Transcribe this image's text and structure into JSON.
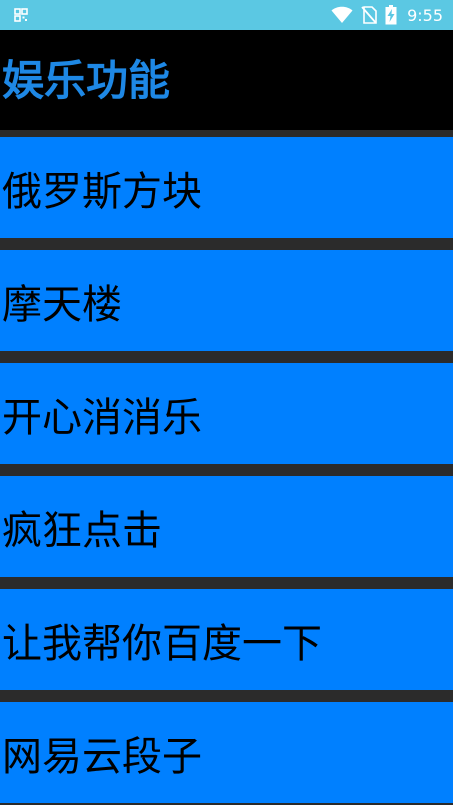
{
  "status_bar": {
    "time": "9:55",
    "icons": [
      "notification-grid-icon",
      "wifi-icon",
      "no-sim-icon",
      "battery-charging-icon"
    ]
  },
  "header": {
    "title": "娱乐功能"
  },
  "menu": {
    "items": [
      {
        "label": "俄罗斯方块"
      },
      {
        "label": "摩天楼"
      },
      {
        "label": "开心消消乐"
      },
      {
        "label": "疯狂点击"
      },
      {
        "label": "让我帮你百度一下"
      },
      {
        "label": "网易云段子"
      }
    ]
  },
  "colors": {
    "status_bar": "#5bc8e3",
    "header_bg": "#000000",
    "title_text": "#1e88e5",
    "item_bg": "#0080ff",
    "divider": "#2b2b2b",
    "item_text": "#000000"
  }
}
